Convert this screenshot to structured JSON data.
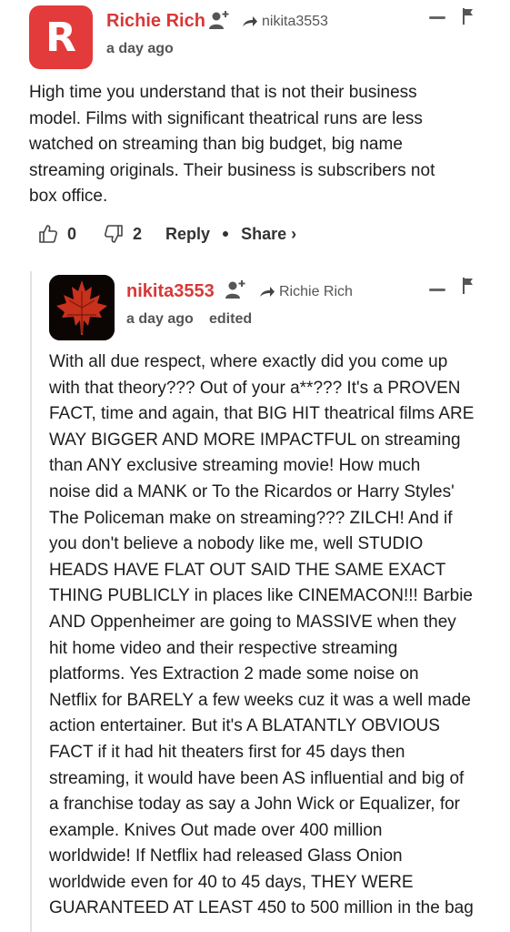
{
  "comment1": {
    "avatar_letter": "R",
    "author": "Richie Rich",
    "reply_to": "nikita3553",
    "time": "a day ago",
    "text_lines": [
      "High time you understand that is not their business",
      "model. Films with significant theatrical runs are less",
      "watched on streaming than big budget, big name",
      "streaming originals. Their business is subscribers not",
      "box office."
    ],
    "likes": "0",
    "dislikes": "2",
    "reply_label": "Reply",
    "share_label": "Share ›"
  },
  "comment2": {
    "author": "nikita3553",
    "reply_to": "Richie Rich",
    "time": "a day ago",
    "edited": "edited",
    "text_lines": [
      "With all due respect, where exactly did you come up",
      "with that theory??? Out of your a**??? It's a PROVEN",
      "FACT, time and again, that BIG HIT theatrical films ARE",
      "WAY BIGGER AND MORE IMPACTFUL on streaming",
      "than ANY exclusive streaming movie! How much",
      "noise did a MANK or To the Ricardos or Harry Styles'",
      "The Policeman make on streaming??? ZILCH! And if",
      "you don't believe a nobody like me, well STUDIO",
      "HEADS HAVE FLAT OUT SAID THE SAME EXACT",
      "THING PUBLICLY in places like CINEMACON!!! Barbie",
      "AND Oppenheimer are going to MASSIVE when they",
      "hit home video and their respective streaming",
      "platforms. Yes Extraction 2 made some noise on",
      "Netflix for BARELY a few weeks cuz it was a well made",
      "action entertainer. But it's A BLATANTLY OBVIOUS",
      "FACT if it had hit theaters first for 45 days then",
      "streaming, it would have been AS influential and big of",
      "a franchise today as say a John Wick or Equalizer, for",
      "example. Knives Out made over 400 million",
      "worldwide! If Netflix had released Glass Onion",
      "worldwide even for 40 to 45 days, THEY WERE",
      "GUARANTEED AT LEAST 450 to 500 million in the bag"
    ]
  },
  "colors": {
    "author": "#d93838",
    "avatar_bg": "#e33b3b",
    "leaf": "#c8311c"
  },
  "icons": [
    "follow-user-icon",
    "reply-arrow-icon",
    "collapse-icon",
    "flag-icon",
    "thumbs-up-icon",
    "thumbs-down-icon",
    "maple-leaf-icon"
  ]
}
